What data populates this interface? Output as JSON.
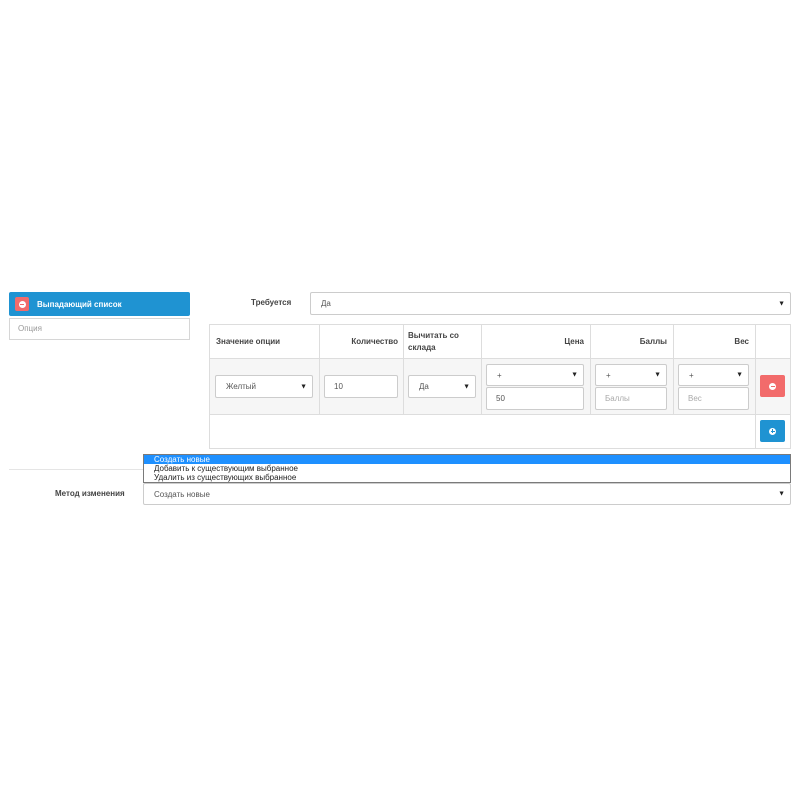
{
  "option_panel": {
    "tab_label": "Выпадающий список",
    "input_placeholder": "Опция"
  },
  "required": {
    "label": "Требуется",
    "value": "Да"
  },
  "table": {
    "headers": [
      "Значение опции",
      "Количество",
      "Вычитать со склада",
      "Цена",
      "Баллы",
      "Вес"
    ],
    "row": {
      "option_value": "Желтый",
      "quantity": "10",
      "subtract": "Да",
      "price_prefix": "+",
      "price": "50",
      "points_prefix": "+",
      "points_placeholder": "Баллы",
      "weight_prefix": "+",
      "weight_placeholder": "Вес"
    }
  },
  "method": {
    "label": "Метод изменения",
    "value": "Создать новые",
    "options": [
      "Создать новые",
      "Добавить к существующим выбранное",
      "Удалить из существующих выбранное"
    ],
    "selected_index": 0
  },
  "colors": {
    "primary": "#1f93d2",
    "danger": "#f26b6b",
    "selection": "#1e90ff"
  }
}
